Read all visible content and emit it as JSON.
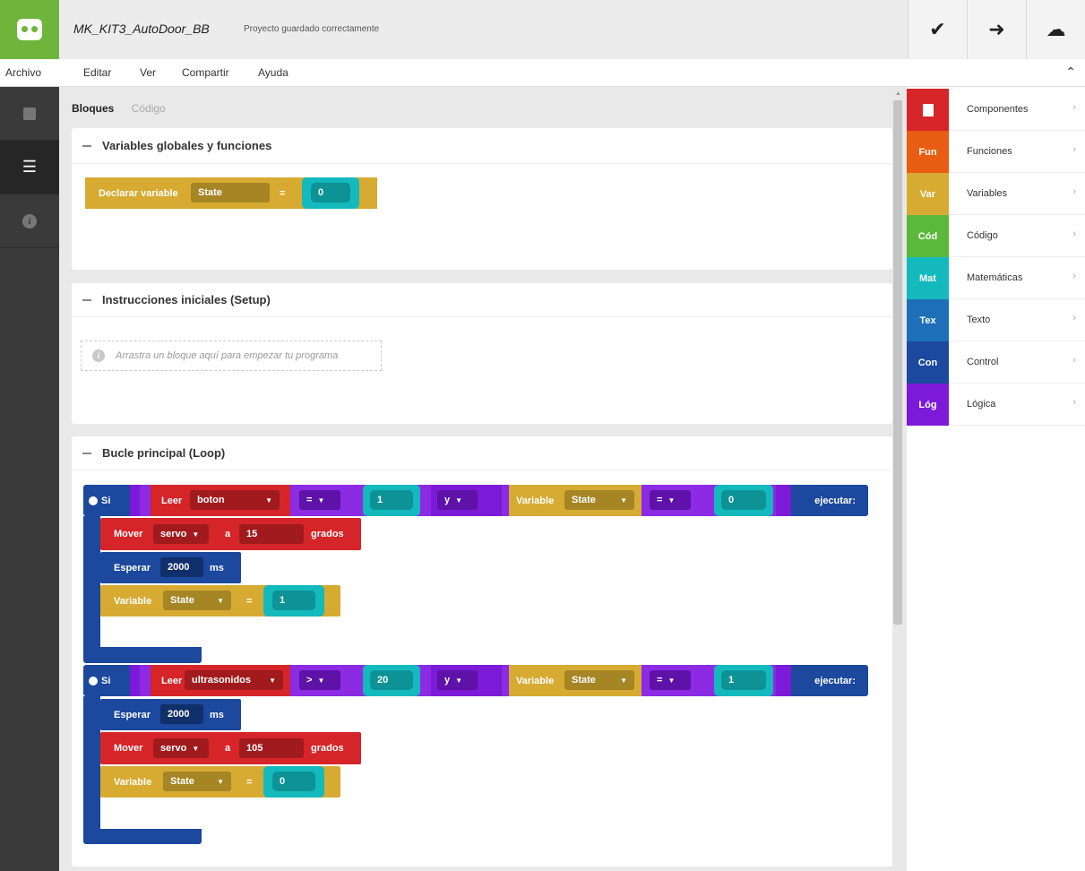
{
  "header": {
    "project_name": "MK_KIT3_AutoDoor_BB",
    "save_status": "Proyecto guardado correctamente",
    "verify_icon": "✔",
    "upload_icon": "➜",
    "cloud_icon": "☁"
  },
  "menu": {
    "items": [
      "Archivo",
      "Editar",
      "Ver",
      "Compartir",
      "Ayuda"
    ],
    "collapse_icon": "⌃"
  },
  "tabs": {
    "blocks": "Bloques",
    "code": "Código"
  },
  "sections": {
    "globals": "Variables globales y funciones",
    "setup": "Instrucciones iniciales (Setup)",
    "setup_placeholder": "Arrastra un bloque aquí para empezar tu programa",
    "loop": "Bucle principal (Loop)"
  },
  "globals_block": {
    "label": "Declarar variable",
    "var_name": "State",
    "op": "=",
    "value": "0"
  },
  "if1": {
    "si": "Si",
    "leer": "Leer",
    "sensor": "boton",
    "op1": "=",
    "val1": "1",
    "and": "y",
    "var_label": "Variable",
    "var_name": "State",
    "op2": "=",
    "val2": "0",
    "exec": "ejecutar:",
    "mover": "Mover",
    "servo": "servo",
    "a": "a",
    "angle": "15",
    "grados": "grados",
    "esperar": "Esperar",
    "ms_value": "2000",
    "ms": "ms",
    "set_label": "Variable",
    "set_var": "State",
    "set_op": "=",
    "set_value": "1"
  },
  "if2": {
    "si": "Si",
    "leer": "Leer",
    "sensor": "ultrasonidos",
    "op1": ">",
    "val1": "20",
    "and": "y",
    "var_label": "Variable",
    "var_name": "State",
    "op2": "=",
    "val2": "1",
    "exec": "ejecutar:",
    "esperar": "Esperar",
    "ms_value": "2000",
    "ms": "ms",
    "mover": "Mover",
    "servo": "servo",
    "a": "a",
    "angle": "105",
    "grados": "grados",
    "set_label": "Variable",
    "set_var": "State",
    "set_op": "=",
    "set_value": "0"
  },
  "palette": [
    {
      "abbr": "",
      "label": "Componentes",
      "color": "#d52529"
    },
    {
      "abbr": "Fun",
      "label": "Funciones",
      "color": "#e85d12"
    },
    {
      "abbr": "Var",
      "label": "Variables",
      "color": "#d7ab32"
    },
    {
      "abbr": "Cód",
      "label": "Código",
      "color": "#5bb83a"
    },
    {
      "abbr": "Mat",
      "label": "Matemáticas",
      "color": "#14b9bd"
    },
    {
      "abbr": "Tex",
      "label": "Texto",
      "color": "#1d6fb8"
    },
    {
      "abbr": "Con",
      "label": "Control",
      "color": "#1c489e"
    },
    {
      "abbr": "Lóg",
      "label": "Lógica",
      "color": "#7c1ad8"
    }
  ],
  "chevron": "›"
}
